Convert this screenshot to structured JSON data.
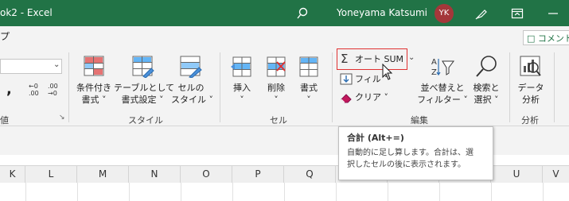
{
  "title_bar": {
    "doc_title": "ok2  -  Excel",
    "user_name": "Yoneyama Katsumi",
    "avatar_initials": "YK"
  },
  "menu": {
    "tab_fragment": "プ",
    "comment_label": "コメント"
  },
  "ribbon": {
    "number": {
      "format_value": "",
      "group_label_fragment": "値"
    },
    "styles": {
      "conditional": [
        "条件付き",
        "書式 ˅"
      ],
      "table": [
        "テーブルとして",
        "書式設定 ˅"
      ],
      "cell": [
        "セルの",
        "スタイル ˅"
      ],
      "group_label": "スタイル"
    },
    "cells": {
      "insert": [
        "挿入",
        "˅"
      ],
      "delete": [
        "削除",
        "˅"
      ],
      "format": [
        "書式",
        "˅"
      ],
      "group_label": "セル"
    },
    "editing": {
      "autosum": "オート SUM",
      "fill": "フィル ˅",
      "clear": "クリア ˅",
      "sort": [
        "並べ替えと",
        "フィルター ˅"
      ],
      "find": [
        "検索と",
        "選択 ˅"
      ],
      "group_label": "編集"
    },
    "analysis": {
      "data_analysis": [
        "データ",
        "分析"
      ],
      "group_label": "分析"
    }
  },
  "tooltip": {
    "title": "合計 (Alt+=)",
    "lines": [
      "自動的に足し算します。合計は、選",
      "択したセルの後に表示されます。"
    ]
  },
  "sheet": {
    "columns": [
      "K",
      "L",
      "M",
      "N",
      "O",
      "P",
      "Q",
      "R",
      "S",
      "T",
      "U",
      "V"
    ]
  },
  "colors": {
    "title_bar": "#217346",
    "avatar": "#a4373a",
    "highlight": "#e03131"
  }
}
